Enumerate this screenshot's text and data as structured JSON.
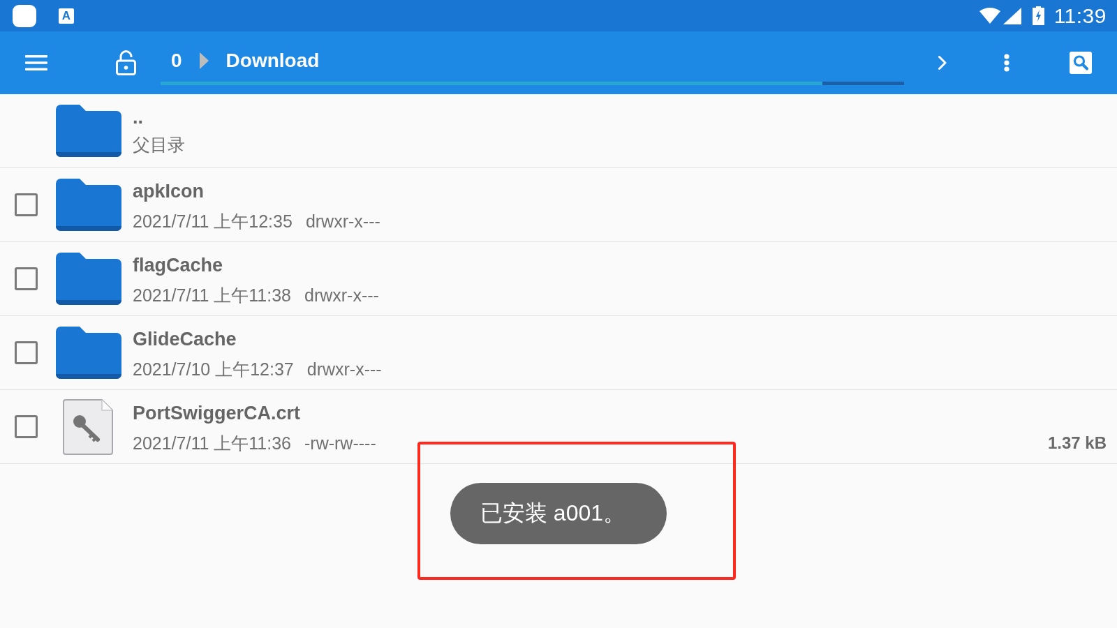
{
  "status_bar": {
    "input_badge": "A",
    "time": "11:39"
  },
  "toolbar": {
    "path": [
      {
        "label": "0"
      },
      {
        "label": "Download"
      }
    ],
    "path_progress": {
      "level": 0.89
    }
  },
  "parent_entry": {
    "name": "..",
    "label": "父目录"
  },
  "files": [
    {
      "kind": "folder",
      "name": "apkIcon",
      "date": "2021/7/11 上午12:35",
      "permissions": "drwxr-x---",
      "checked": false
    },
    {
      "kind": "folder",
      "name": "flagCache",
      "date": "2021/7/11 上午11:38",
      "permissions": "drwxr-x---",
      "checked": false
    },
    {
      "kind": "folder",
      "name": "GlideCache",
      "date": "2021/7/10 上午12:37",
      "permissions": "drwxr-x---",
      "checked": false
    },
    {
      "kind": "certificate",
      "name": "PortSwiggerCA.crt",
      "date": "2021/7/11 上午11:36",
      "permissions": "-rw-rw----",
      "size": "1.37 kB",
      "checked": false
    }
  ],
  "toast": {
    "message": "已安装 a001。"
  }
}
